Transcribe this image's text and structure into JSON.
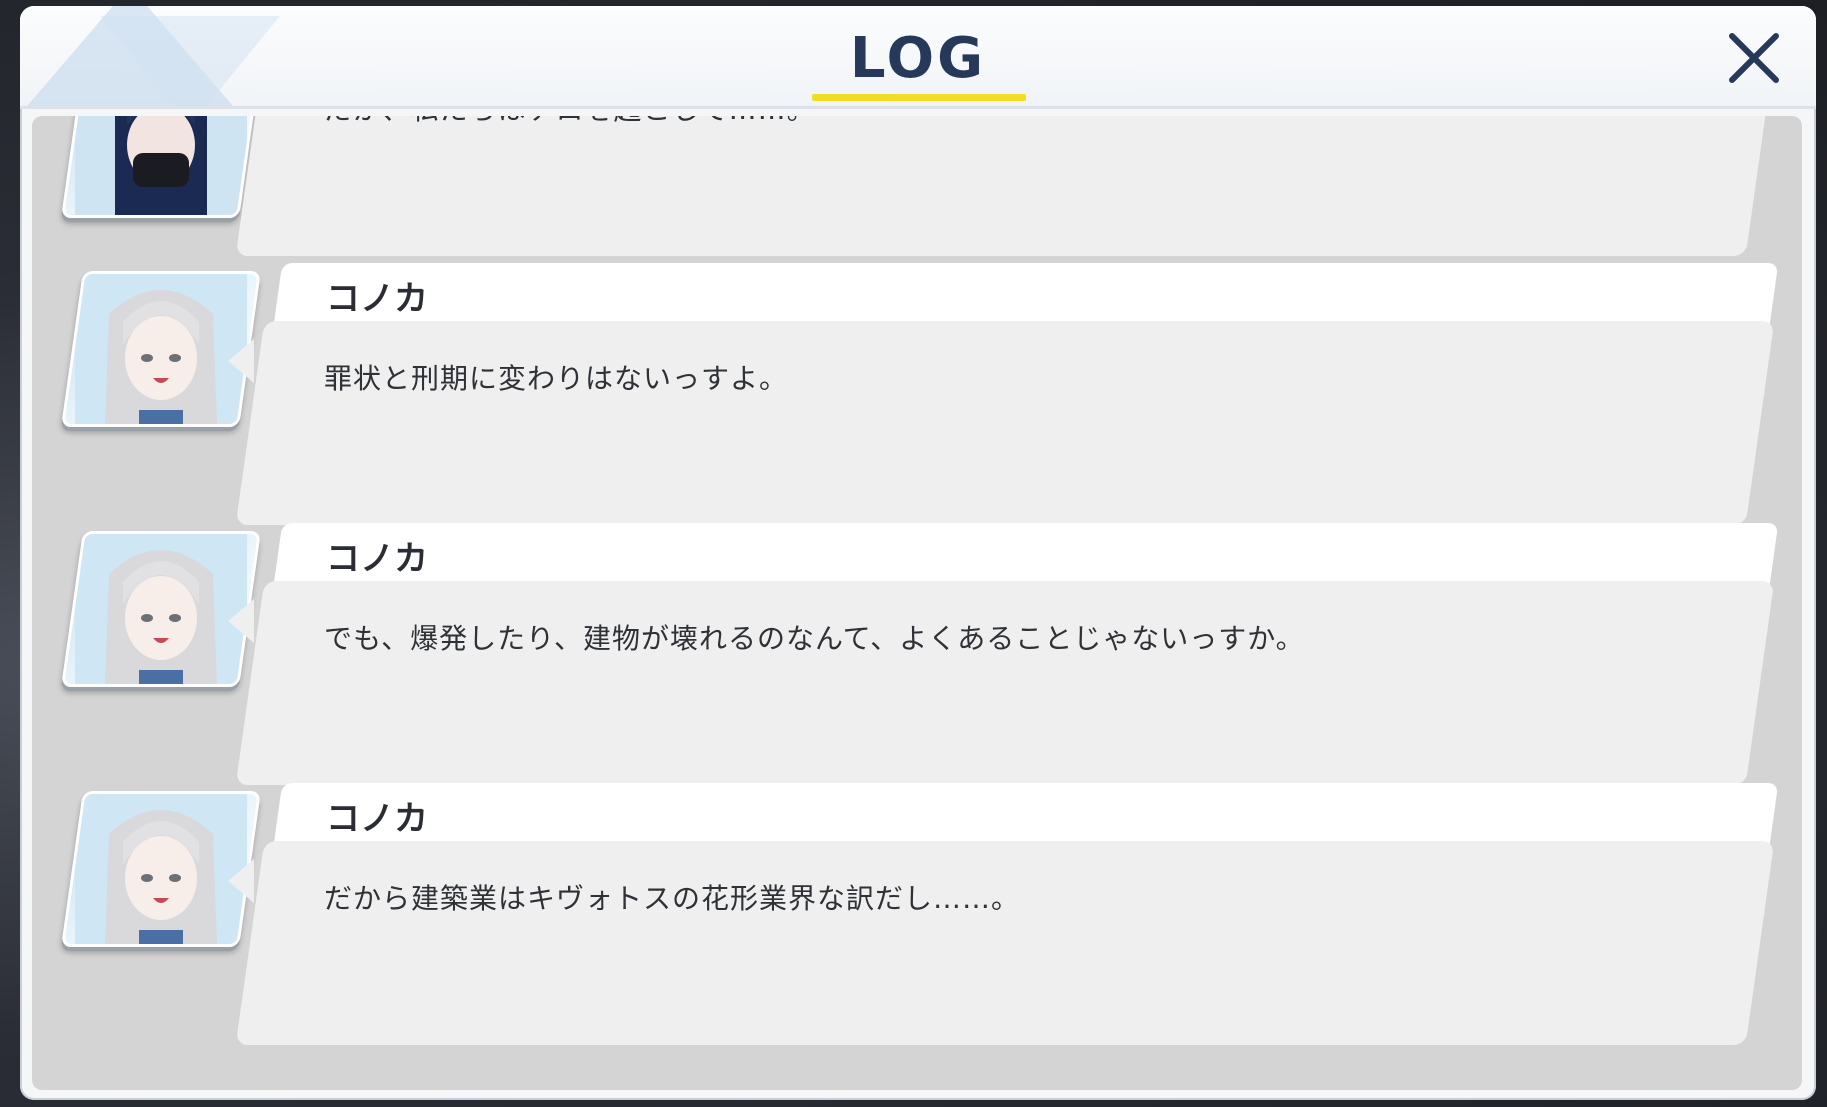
{
  "window": {
    "title": "LOG",
    "close_label": "close"
  },
  "colors": {
    "title": "#27395a",
    "underline": "#f2dc27",
    "log_background": "#d4d4d4",
    "bubble": "#efefef",
    "name_bar": "#ffffff"
  },
  "entries": [
    {
      "speaker": "",
      "avatar": "masked-dark-hair-character",
      "text": "だが、私たちはテロを起こして……。"
    },
    {
      "speaker": "コノカ",
      "avatar": "konoka-portrait",
      "text": "罪状と刑期に変わりはないっすよ。"
    },
    {
      "speaker": "コノカ",
      "avatar": "konoka-portrait",
      "text": "でも、爆発したり、建物が壊れるのなんて、よくあることじゃないっすか。"
    },
    {
      "speaker": "コノカ",
      "avatar": "konoka-portrait",
      "text": "だから建築業はキヴォトスの花形業界な訳だし……。"
    }
  ]
}
